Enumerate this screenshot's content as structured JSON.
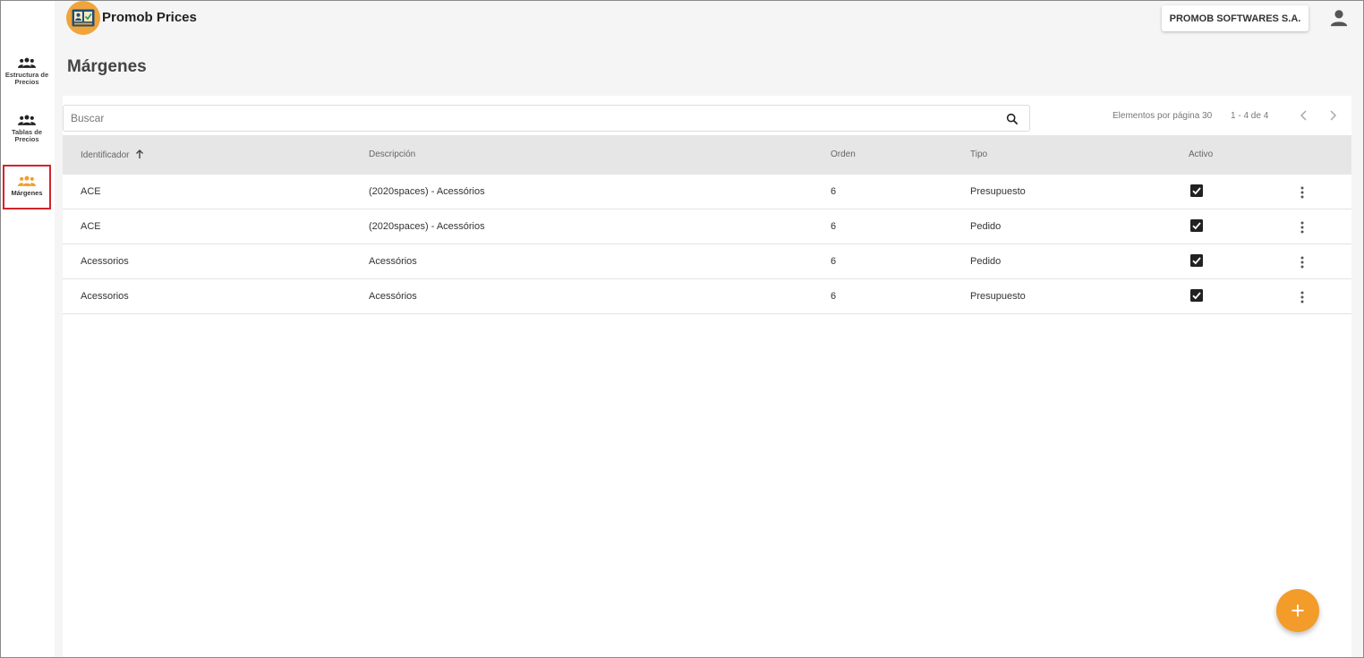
{
  "app": {
    "title": "Promob Prices"
  },
  "header": {
    "company": "PROMOB SOFTWARES S.A."
  },
  "sidebar": {
    "items": [
      {
        "label_line1": "Estructura de",
        "label_line2": "Precios",
        "active": false
      },
      {
        "label_line1": "Tablas de",
        "label_line2": "Precios",
        "active": false
      },
      {
        "label_line1": "Márgenes",
        "label_line2": "",
        "active": true
      }
    ]
  },
  "page": {
    "title": "Márgenes"
  },
  "search": {
    "placeholder": "Buscar"
  },
  "pagination": {
    "page_size_label": "Elementos por página 30",
    "range": "1 - 4 de 4"
  },
  "table": {
    "columns": [
      "Identificador",
      "Descripción",
      "Orden",
      "Tipo",
      "Activo"
    ],
    "sort_column": "Identificador",
    "sort_direction": "ascending",
    "rows": [
      {
        "id": "ACE",
        "description": "(2020spaces) - Acessórios",
        "order": "6",
        "type": "Presupuesto",
        "active": true
      },
      {
        "id": "ACE",
        "description": "(2020spaces) - Acessórios",
        "order": "6",
        "type": "Pedido",
        "active": true
      },
      {
        "id": "Acessorios",
        "description": "Acessórios",
        "order": "6",
        "type": "Pedido",
        "active": true
      },
      {
        "id": "Acessorios",
        "description": "Acessórios",
        "order": "6",
        "type": "Presupuesto",
        "active": true
      }
    ]
  },
  "colors": {
    "accent": "#f39c2a",
    "active_outline": "#d3242b",
    "header_bg": "#e6e6e6"
  },
  "icons": {
    "sidebar": "group-icon",
    "search": "search-icon",
    "user": "account-icon",
    "fab": "plus-icon",
    "row_menu": "more-vert-icon"
  }
}
